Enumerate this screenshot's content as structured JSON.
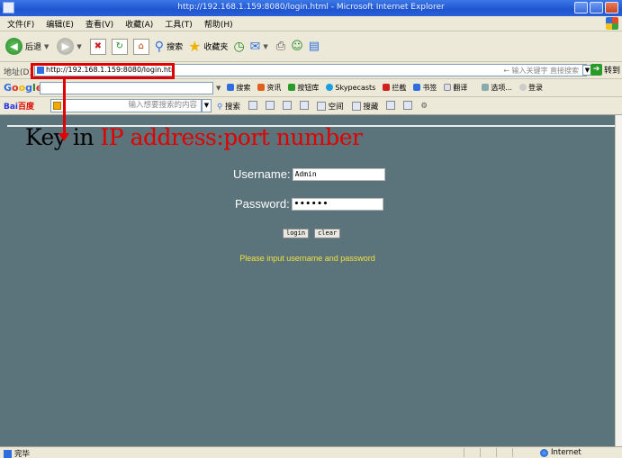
{
  "window": {
    "title": "http://192.168.1.159:8080/login.html - Microsoft Internet Explorer"
  },
  "menu": [
    "文件(F)",
    "编辑(E)",
    "查看(V)",
    "收藏(A)",
    "工具(T)",
    "帮助(H)"
  ],
  "toolbar": {
    "back_label": "后退",
    "search_label": "搜索",
    "favorites_label": "收藏夹"
  },
  "address": {
    "label": "地址(D)",
    "url": "http://192.168.1.159:8080/login.html",
    "hint": "← 输入关键字 直接搜索",
    "go_label": "转到"
  },
  "google_bar": {
    "logo": "Google",
    "items": [
      "搜索",
      "资讯",
      "按钮库",
      "Skypecasts",
      "拦截",
      "书签",
      "翻译",
      "选项...",
      "登录"
    ]
  },
  "baidu_bar": {
    "logo_a": "Bai",
    "logo_b": "百度",
    "placeholder": "输入想要搜索的内容",
    "search_label": "搜索",
    "space_label": "空间",
    "post_label": "搜藏"
  },
  "annotation": {
    "black_text": "Key in ",
    "red_text": "IP address:port number"
  },
  "login": {
    "username_label": "Username:",
    "username_value": "Admin",
    "password_label": "Password:",
    "password_value": "••••••",
    "login_button": "login",
    "clear_button": "clear",
    "message": "Please input username and password"
  },
  "status": {
    "left": "完毕",
    "zone": "Internet"
  },
  "colors": {
    "content_bg": "#5b747b",
    "annotation_red": "#e00000",
    "message_yellow": "#f0e040"
  }
}
